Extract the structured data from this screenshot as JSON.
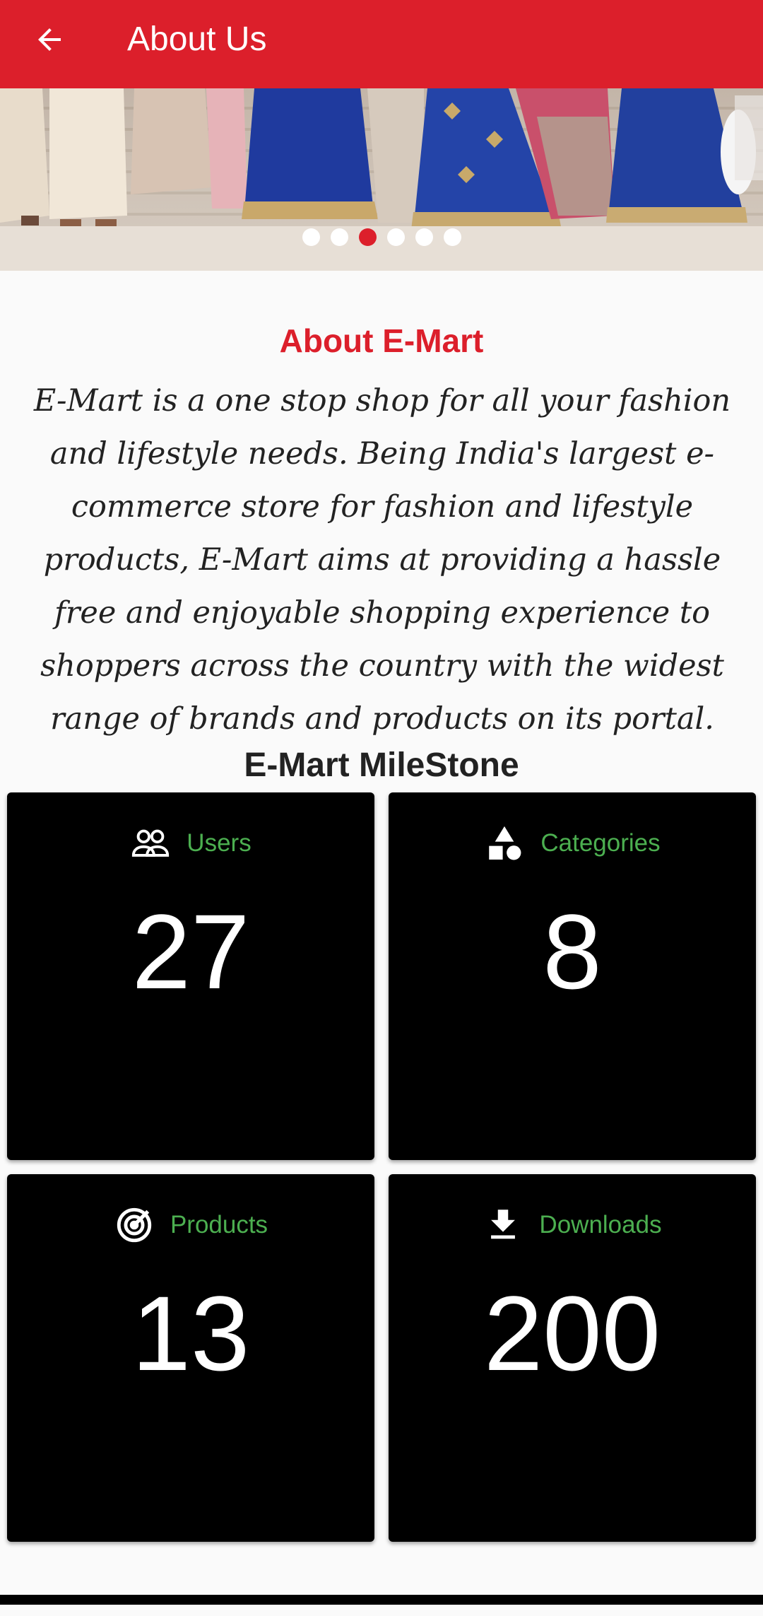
{
  "appbar": {
    "title": "About Us",
    "back_icon": "arrow-left-icon",
    "color": "#dc1f2b"
  },
  "banner": {
    "dots_total": 6,
    "active_dot": 3
  },
  "about": {
    "heading": "About E-Mart",
    "text": "E-Mart is a one stop shop for all your fashion and lifestyle needs. Being India's largest e-commerce store for fashion and lifestyle products, E-Mart aims at providing a hassle free and enjoyable shopping experience to shoppers across the country with the widest range of brands and products on its portal."
  },
  "milestone": {
    "heading": "E-Mart MileStone",
    "cards": [
      {
        "label": "Users",
        "value": "27",
        "icon": "users-icon"
      },
      {
        "label": "Categories",
        "value": "8",
        "icon": "categories-icon"
      },
      {
        "label": "Products",
        "value": "13",
        "icon": "products-icon"
      },
      {
        "label": "Downloads",
        "value": "200",
        "icon": "download-icon"
      }
    ]
  }
}
